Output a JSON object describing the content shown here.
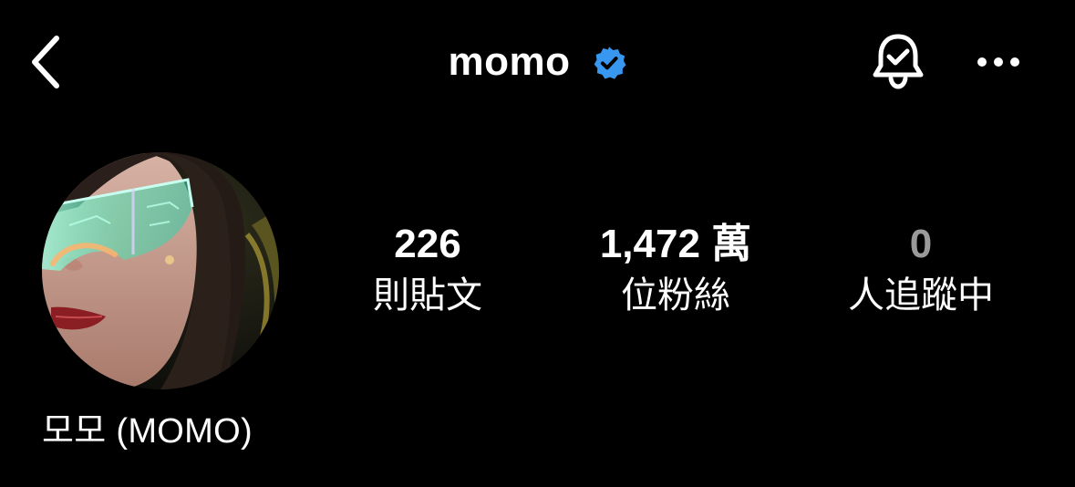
{
  "header": {
    "username": "momo",
    "icons": {
      "back": "chevron-left-icon",
      "verified": "verified-badge-icon",
      "notifications": "bell-check-icon",
      "more": "ellipsis-icon"
    }
  },
  "profile": {
    "display_name": "모모 (MOMO)",
    "avatar": "profile-photo"
  },
  "stats": {
    "posts": {
      "value": "226",
      "label": "則貼文"
    },
    "followers": {
      "value": "1,472 萬",
      "label": "位粉絲"
    },
    "following": {
      "value": "0",
      "label": "人追蹤中"
    }
  },
  "colors": {
    "background": "#000000",
    "text": "#ffffff",
    "verified": "#3897f0",
    "dim_text": "#9a9a9a"
  }
}
